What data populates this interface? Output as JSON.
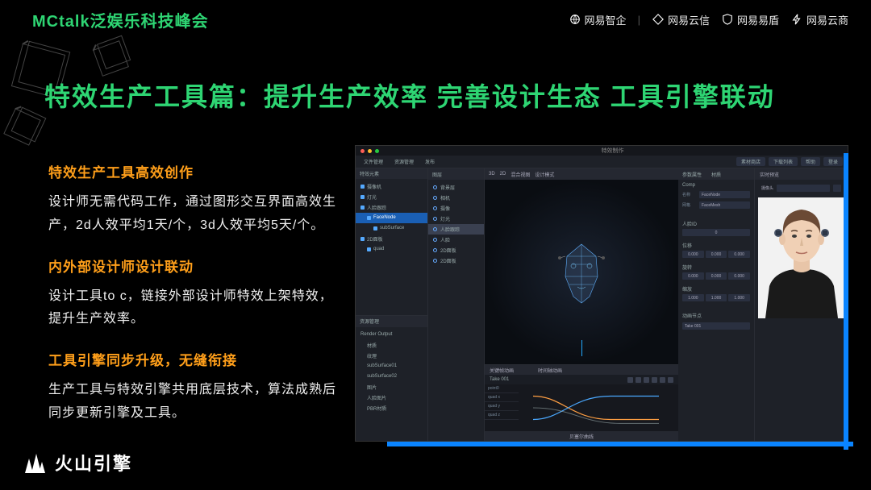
{
  "header": {
    "event_title": "MCtalk泛娱乐科技峰会",
    "brands": [
      "网易智企",
      "网易云信",
      "网易易盾",
      "网易云商"
    ]
  },
  "slide": {
    "title": "特效生产工具篇：提升生产效率 完善设计生态 工具引擎联动"
  },
  "sections": [
    {
      "head": "特效生产工具高效创作",
      "body": "设计师无需代码工作，通过图形交互界面高效生产，2d人效平均1天/个，3d人效平均5天/个。"
    },
    {
      "head": "内外部设计师设计联动",
      "body": "设计工具to c，链接外部设计师特效上架特效，提升生产效率。"
    },
    {
      "head": "工具引擎同步升级，无缝衔接",
      "body": "生产工具与特效引擎共用底层技术，算法成熟后同步更新引擎及工具。"
    }
  ],
  "app": {
    "window_title": "特效制作",
    "toolbar_left": [
      "文件管理",
      "资源管理",
      "发布"
    ],
    "toolbar_right": [
      "素材商店",
      "下载列表",
      "帮助",
      "登录"
    ],
    "left_panel": {
      "title": "特效元素",
      "tree": [
        {
          "label": "摄像机",
          "indent": 0
        },
        {
          "label": "灯光",
          "indent": 0
        },
        {
          "label": "人脸跟踪",
          "indent": 0,
          "expanded": true
        },
        {
          "label": "FaceNode",
          "indent": 1,
          "sel": true
        },
        {
          "label": "subSurface",
          "indent": 2
        },
        {
          "label": "2D面板",
          "indent": 0
        },
        {
          "label": "quad",
          "indent": 1
        }
      ],
      "lower_title": "资源管理",
      "outputs": [
        {
          "label": "Render Output"
        },
        {
          "label": "材质"
        },
        {
          "label": "纹理"
        },
        {
          "label": "subSurface01"
        },
        {
          "label": "subSurface02"
        },
        {
          "label": "图片"
        },
        {
          "label": "人脸图片"
        },
        {
          "label": "PBR材质"
        }
      ]
    },
    "layers": {
      "title": "图层",
      "items": [
        "背景层",
        "相机",
        "摄像",
        "灯光",
        "人脸跟踪",
        "人脸",
        "2D面板",
        "2D面板"
      ]
    },
    "viewport": {
      "tabs": [
        "3D",
        "2D",
        "混合视图",
        "设计模式"
      ],
      "timeline": {
        "head_left": "关键帧动画",
        "head_right": "时间轴动画",
        "take_label": "Take 001",
        "tracks": [
          "point0",
          "quad x",
          "quad y",
          "quad z"
        ],
        "footer": "贝塞尔曲线"
      }
    },
    "props": {
      "tabs": [
        "参数属性",
        "材质"
      ],
      "comp_label": "Comp",
      "name_field": "FaceNode",
      "mesh_field": "FaceMesh",
      "groups": [
        {
          "label": "人脸ID",
          "values": [
            "0"
          ]
        },
        {
          "label": "位移",
          "values": [
            "0.000",
            "0.000",
            "0.000"
          ]
        },
        {
          "label": "旋转",
          "values": [
            "0.000",
            "0.000",
            "0.000"
          ]
        },
        {
          "label": "缩放",
          "values": [
            "1.000",
            "1.000",
            "1.000"
          ]
        }
      ],
      "section2": "动画节点",
      "take_sel": "Take 001"
    },
    "preview": {
      "title": "实时预览",
      "camera": "摄像头"
    }
  },
  "footer": {
    "brand": "火山引擎"
  }
}
